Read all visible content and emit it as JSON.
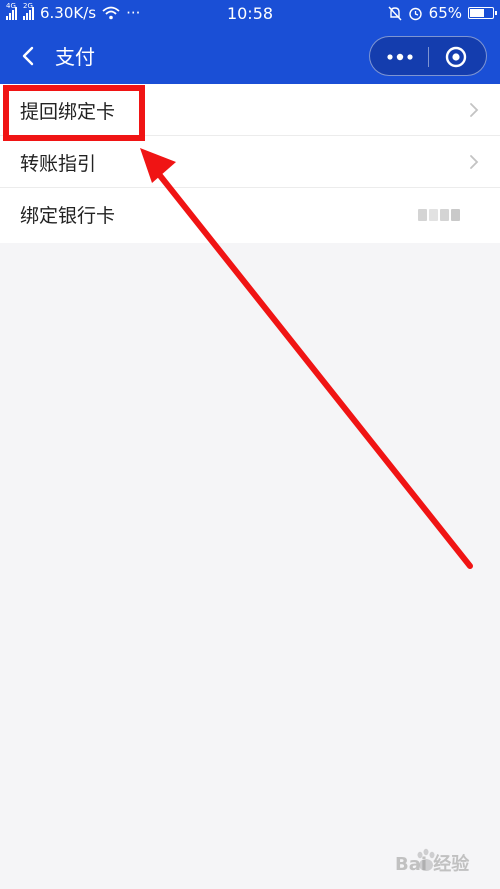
{
  "status_bar": {
    "network_1": "4G",
    "network_2": "2G",
    "speed": "6.30K/s",
    "more": "···",
    "time": "10:58",
    "battery": "65%",
    "battery_level": 0.65,
    "icons": [
      "signal-icon",
      "wifi-icon",
      "mute-icon",
      "alarm-icon",
      "battery-icon"
    ]
  },
  "nav": {
    "title": "支付",
    "back_icon": "chevron-left-icon",
    "more_icon": "more-dots-icon",
    "close_icon": "target-circle-icon"
  },
  "menu": {
    "items": [
      {
        "label": "提回绑定卡",
        "trailing": "chevron-right-icon"
      },
      {
        "label": "转账指引",
        "trailing": "chevron-right-icon"
      },
      {
        "label": "绑定银行卡",
        "trailing": "masked-value"
      }
    ]
  },
  "annotation": {
    "color": "#f01414",
    "highlight": "提回绑定卡"
  },
  "colors": {
    "header": "#1a4fd6",
    "background": "#f5f5f7",
    "annotation": "#f01414"
  },
  "watermark": {
    "text": "Bai 经验"
  }
}
